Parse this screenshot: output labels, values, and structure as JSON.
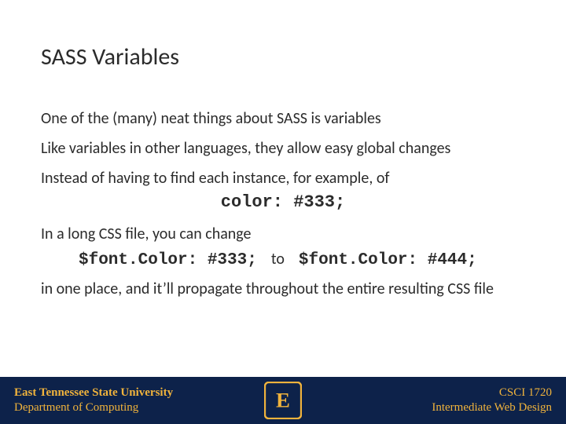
{
  "title": "SASS Variables",
  "body": {
    "p1": "One of the (many) neat things about SASS is variables",
    "p2": "Like variables in other languages, they allow easy global changes",
    "p3": "Instead of having to find each instance, for example, of",
    "code_center": "color: #333;",
    "p4": "In a long CSS file, you can change",
    "code_from": "$font.Color: #333;",
    "to_word": "to",
    "code_to": "$font.Color: #444;",
    "p5": "in one place, and it’ll propagate throughout the entire resulting CSS file"
  },
  "footer": {
    "university": "East Tennessee State University",
    "department": "Department of Computing",
    "course_code": "CSCI 1720",
    "course_name": "Intermediate Web Design",
    "logo_letter": "E"
  },
  "colors": {
    "footer_bg": "#0d224a",
    "accent": "#f0b33c"
  }
}
